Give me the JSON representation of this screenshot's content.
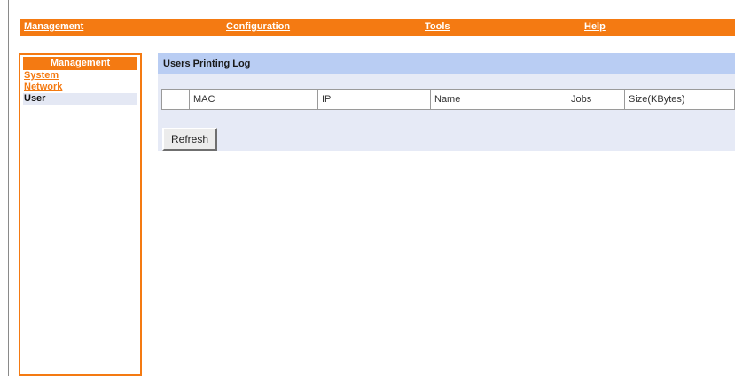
{
  "topnav": {
    "items": [
      {
        "label": "Management"
      },
      {
        "label": "Configuration"
      },
      {
        "label": "Tools"
      },
      {
        "label": "Help"
      }
    ]
  },
  "sidebar": {
    "header": "Management",
    "items": [
      {
        "label": "System",
        "active": false
      },
      {
        "label": "Network",
        "active": false
      },
      {
        "label": "User",
        "active": true
      }
    ]
  },
  "main": {
    "title": "Users Printing Log",
    "table": {
      "columns": [
        "",
        "MAC",
        "IP",
        "Name",
        "Jobs",
        "Size(KBytes)"
      ],
      "rows": []
    },
    "refresh_label": "Refresh"
  },
  "colors": {
    "accent": "#f47a12",
    "panel_bg": "#e6eaf6",
    "title_bg": "#b9cdf3"
  }
}
